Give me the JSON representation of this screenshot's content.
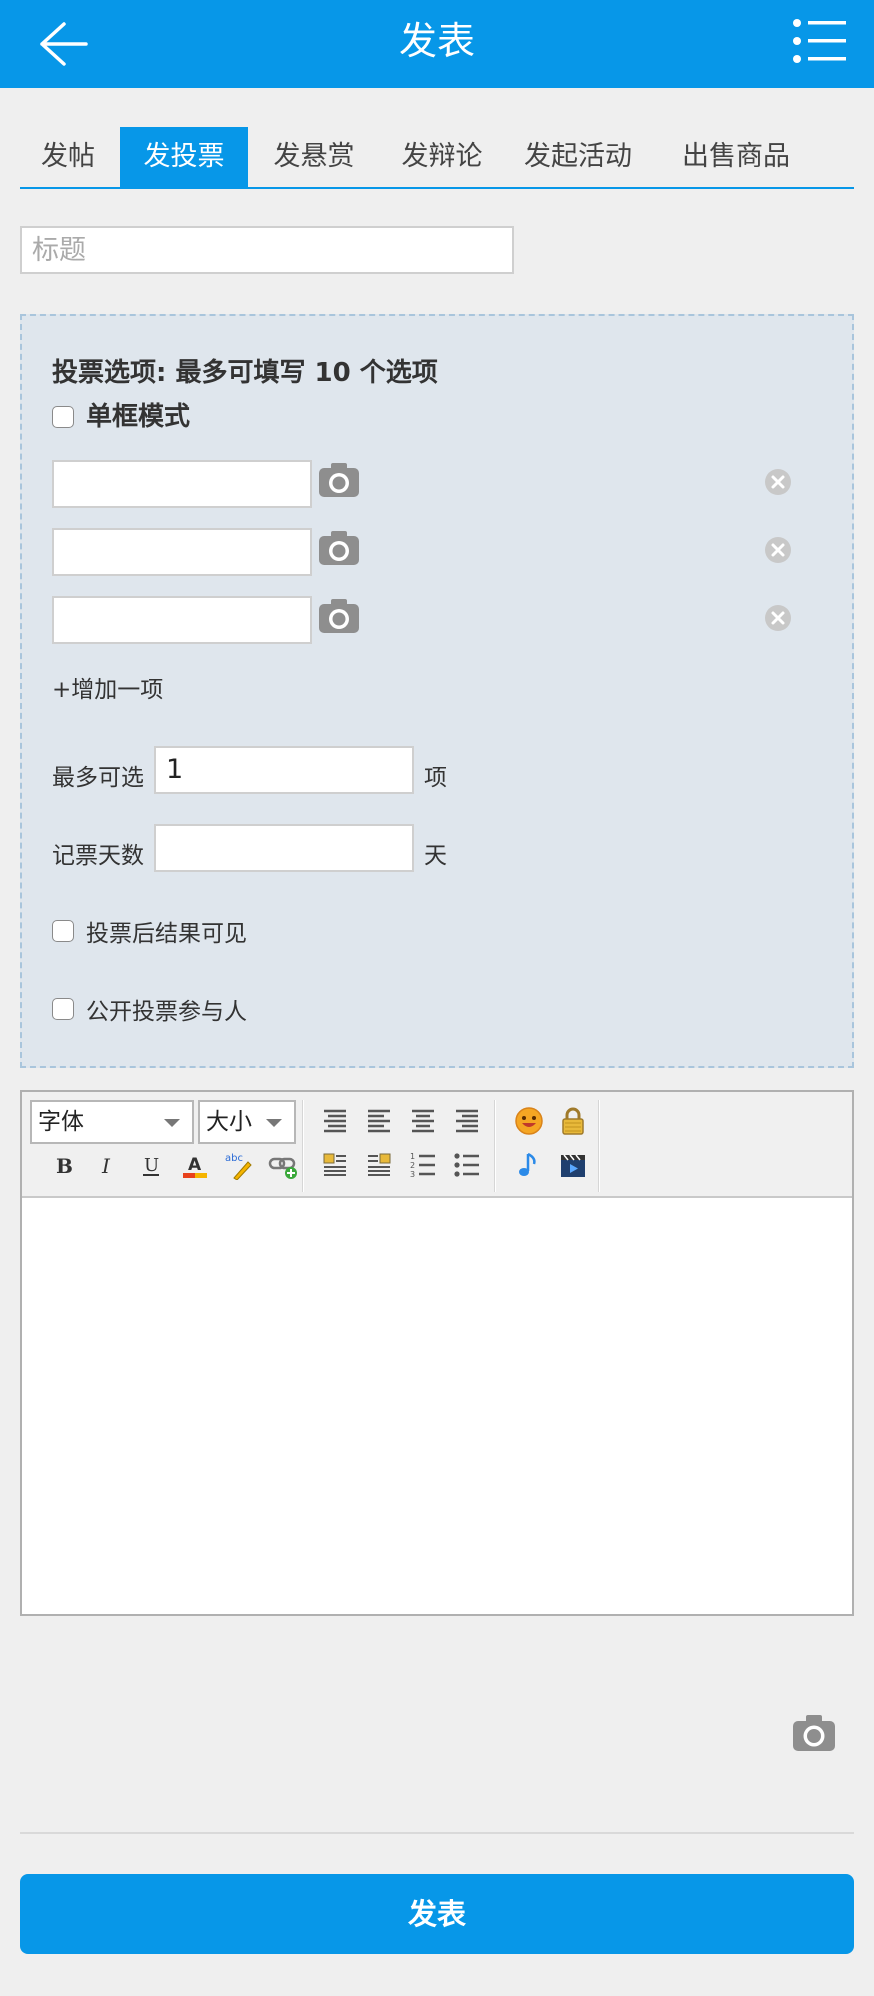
{
  "header": {
    "title": "发表",
    "back_icon": "arrow-left-icon",
    "menu_icon": "list-menu-icon"
  },
  "tabs": [
    {
      "label": "发帖",
      "active": false
    },
    {
      "label": "发投票",
      "active": true
    },
    {
      "label": "发悬赏",
      "active": false
    },
    {
      "label": "发辩论",
      "active": false
    },
    {
      "label": "发起活动",
      "active": false
    },
    {
      "label": "出售商品",
      "active": false
    }
  ],
  "title_field": {
    "placeholder": "标题",
    "value": ""
  },
  "poll": {
    "heading": "投票选项: 最多可填写 10 个选项",
    "single_mode_label": "单框模式",
    "options": [
      {
        "value": ""
      },
      {
        "value": ""
      },
      {
        "value": ""
      }
    ],
    "add_option_label": "+增加一项",
    "max_choices": {
      "label": "最多可选",
      "value": "1",
      "unit": "项"
    },
    "days": {
      "label": "记票天数",
      "value": "",
      "unit": "天"
    },
    "result_visible_label": "投票后结果可见",
    "public_voters_label": "公开投票参与人"
  },
  "editor": {
    "font_select": "字体",
    "size_select": "大小",
    "tools": [
      "bold-icon",
      "italic-icon",
      "underline-icon",
      "font-color-icon",
      "highlight-icon",
      "link-icon",
      "align-justify-icon",
      "align-left-icon",
      "align-center-icon",
      "align-right-icon",
      "float-left-icon",
      "float-right-icon",
      "ordered-list-icon",
      "unordered-list-icon",
      "emoji-icon",
      "lock-icon",
      "music-icon",
      "video-icon"
    ]
  },
  "submit_label": "发表",
  "colors": {
    "primary": "#0797e8",
    "poll_bg": "#dfe6ed"
  }
}
